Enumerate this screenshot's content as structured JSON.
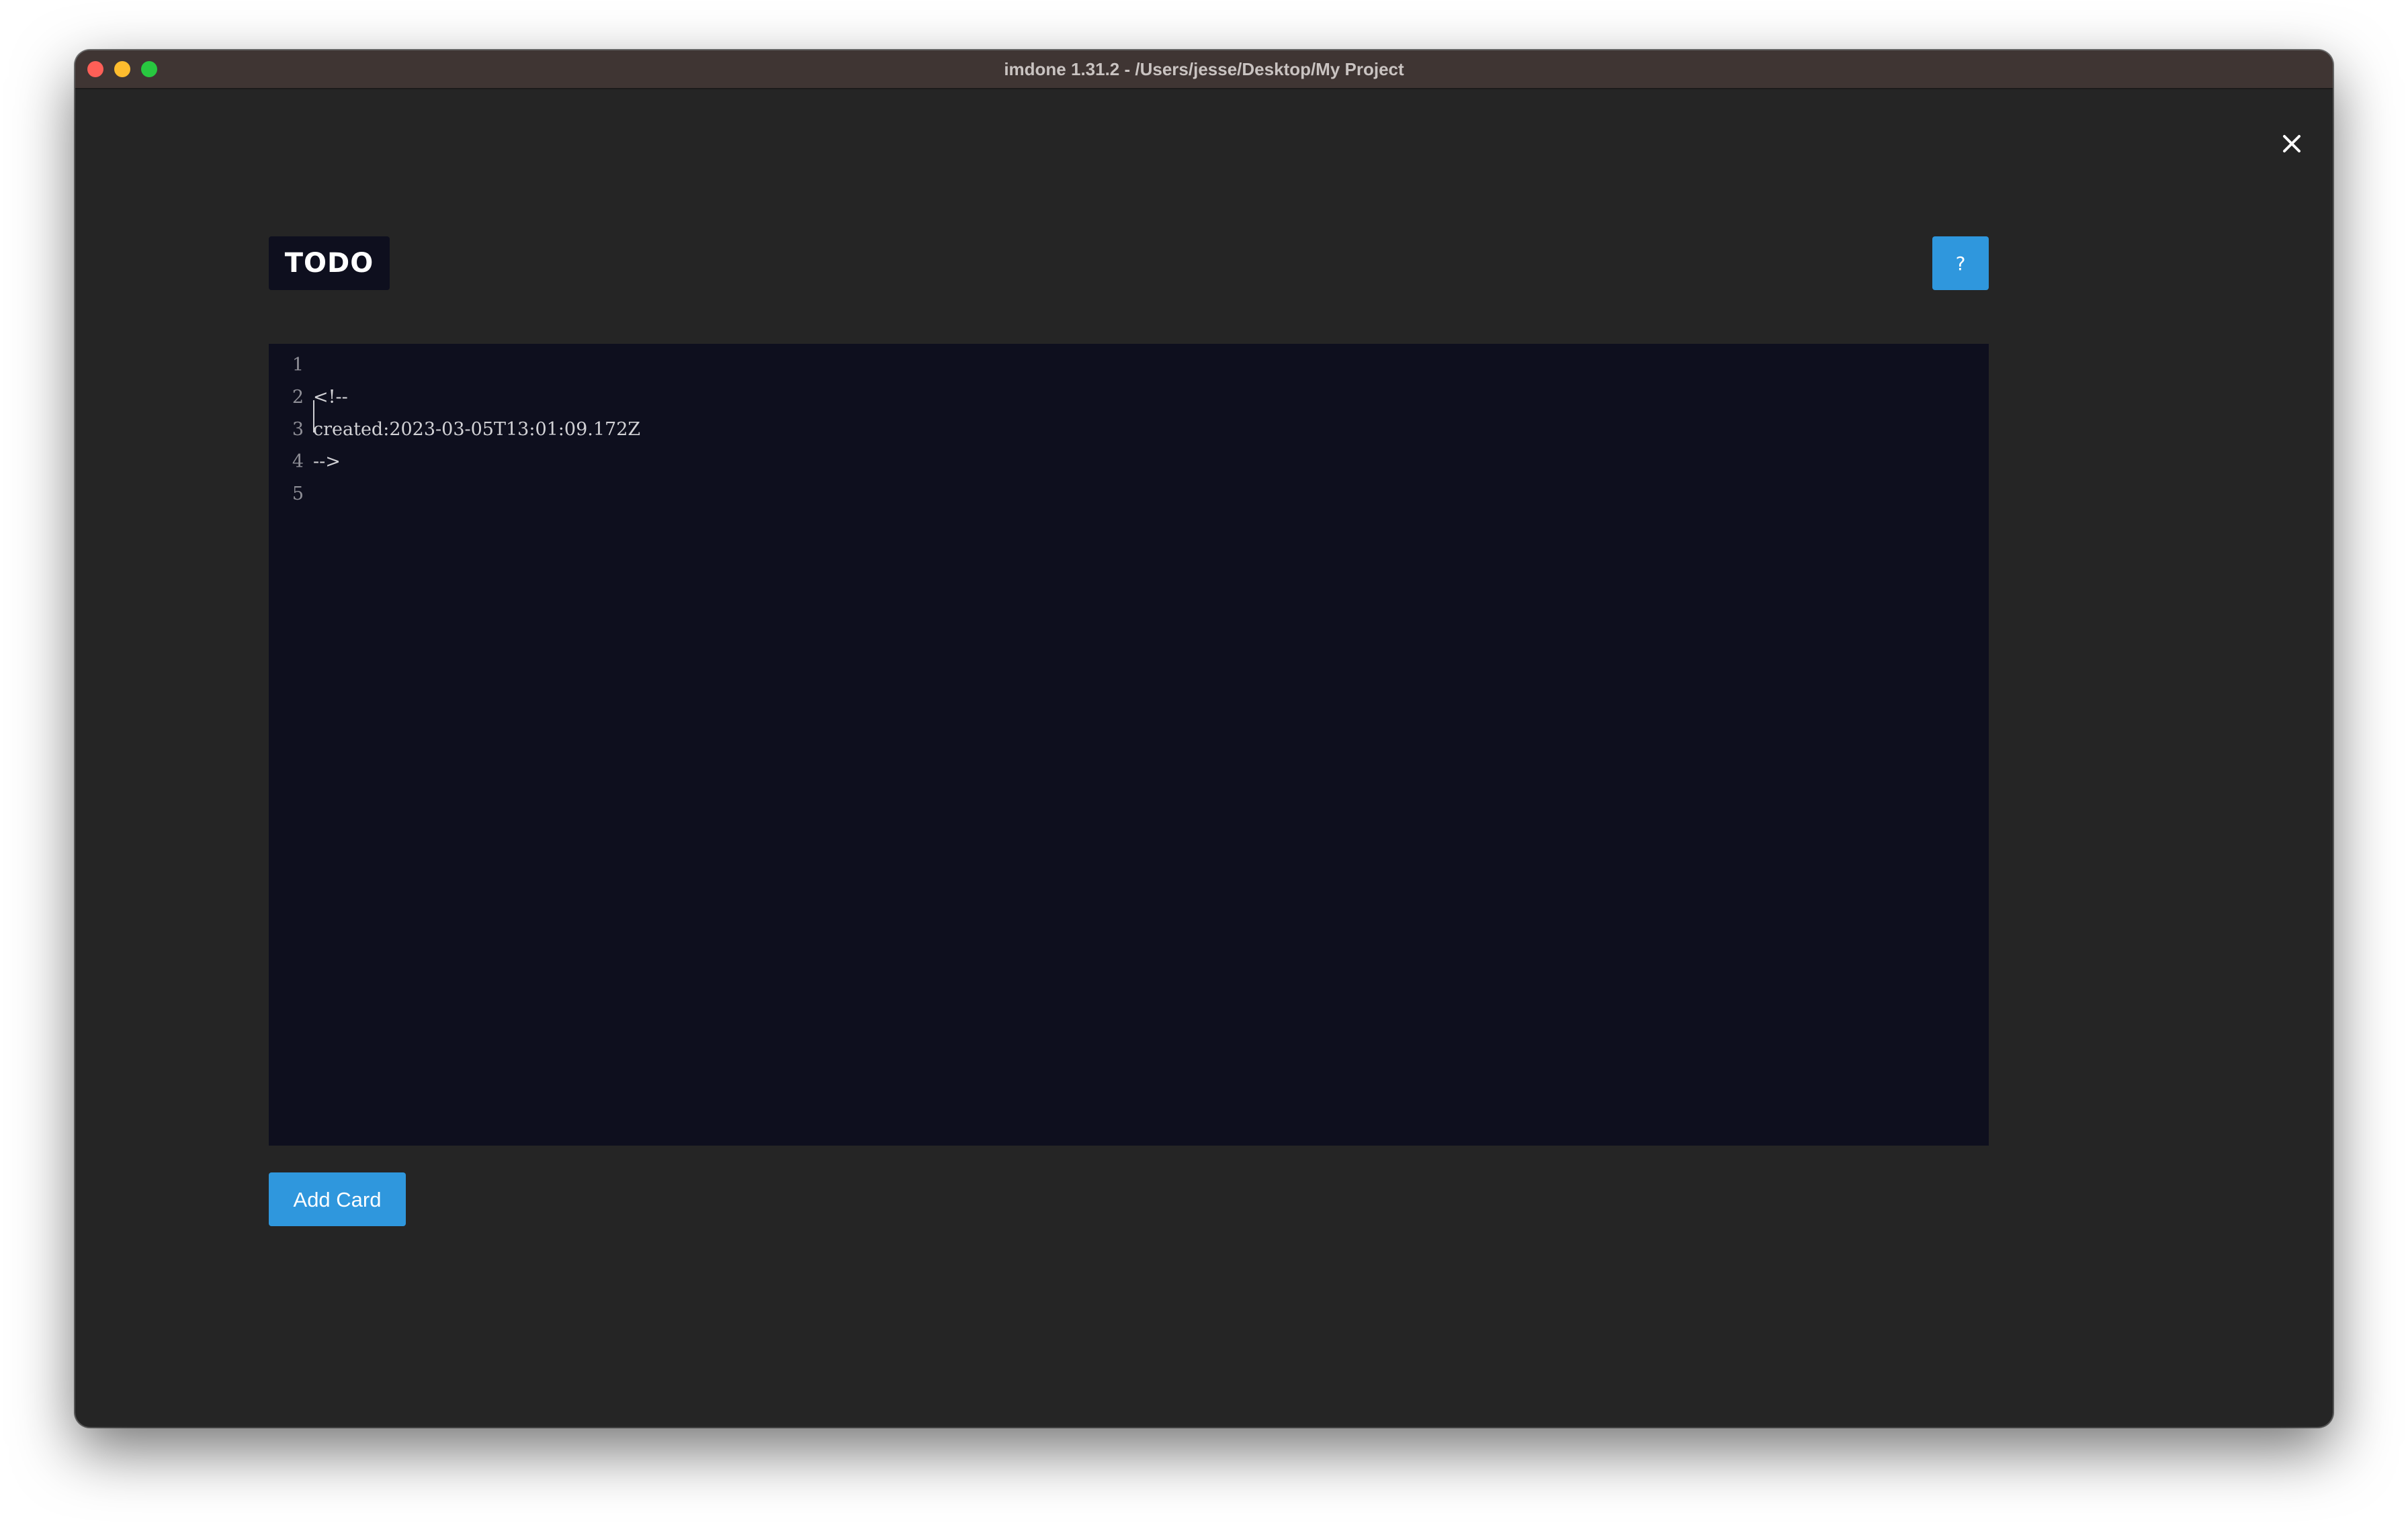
{
  "window": {
    "title": "imdone 1.31.2 - /Users/jesse/Desktop/My Project"
  },
  "close_icon": "close-icon",
  "card": {
    "list_name": "TODO",
    "help_label": "?"
  },
  "editor": {
    "lines": [
      {
        "number": "1",
        "text": ""
      },
      {
        "number": "2",
        "text": "<!--"
      },
      {
        "number": "3",
        "text": "created:2023-03-05T13:01:09.172Z"
      },
      {
        "number": "4",
        "text": "-->"
      },
      {
        "number": "5",
        "text": ""
      }
    ]
  },
  "actions": {
    "add_card_label": "Add Card"
  },
  "colors": {
    "accent": "#2f97dd",
    "background": "#252525",
    "editor_background": "#0e0f1e",
    "titlebar": "#3f3533"
  }
}
